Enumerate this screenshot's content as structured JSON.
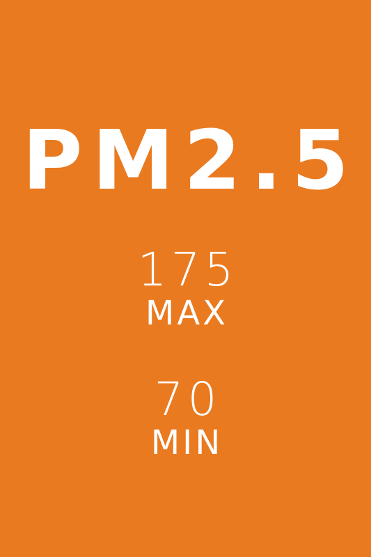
{
  "colors": {
    "background": "#e97a1f",
    "text": "#ffffff"
  },
  "pollutant": {
    "name": "PM2.5"
  },
  "max": {
    "value": "175",
    "label": "MAX"
  },
  "min": {
    "value": "70",
    "label": "MIN"
  }
}
